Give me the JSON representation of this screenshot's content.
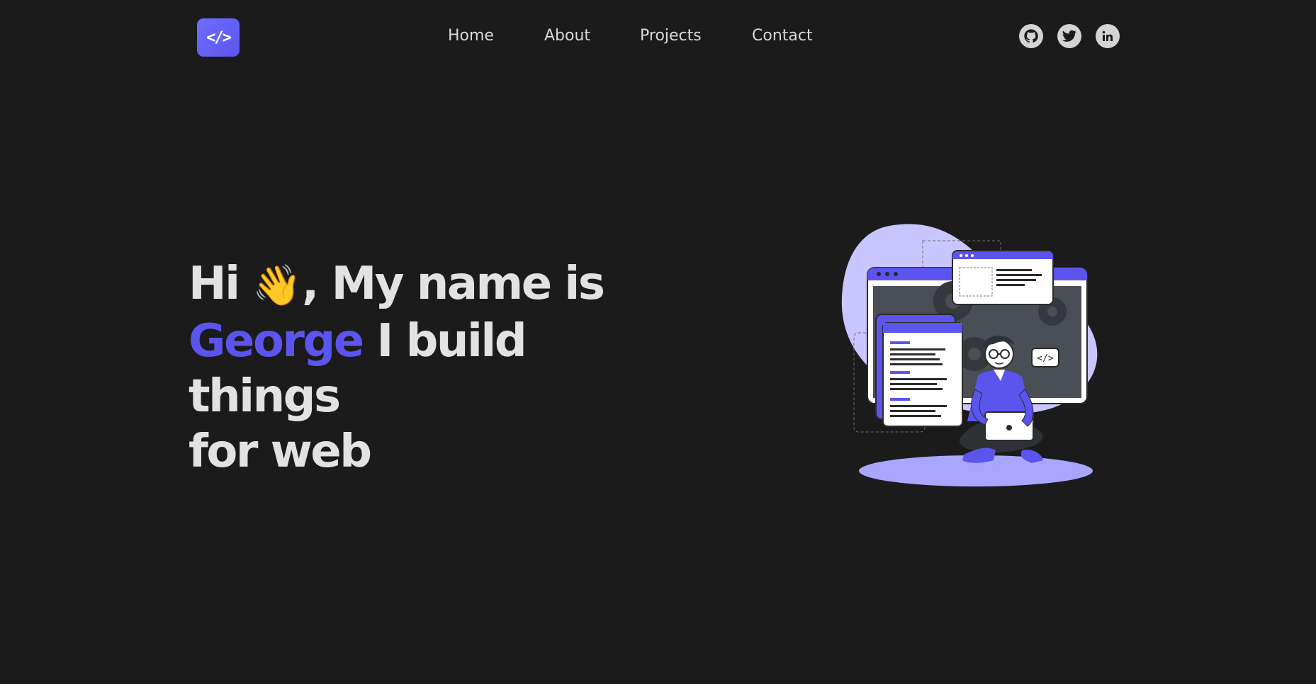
{
  "header": {
    "logo_text": "</>",
    "nav": [
      {
        "label": "Home"
      },
      {
        "label": "About"
      },
      {
        "label": "Projects"
      },
      {
        "label": "Contact"
      }
    ],
    "socials": [
      {
        "icon": "github-icon"
      },
      {
        "icon": "twitter-icon"
      },
      {
        "icon": "linkedin-icon"
      }
    ]
  },
  "hero": {
    "line1_start": "Hi",
    "wave_emoji": "👋",
    "line1_end": ", My name is",
    "name": "George",
    "line2_rest": " I build things",
    "line3": "for web"
  },
  "illustration": {
    "code_tag": "</>"
  },
  "colors": {
    "background": "#1b1b1b",
    "accent": "#5b55ee",
    "text": "#e2e2e2",
    "blob": "#c9c6ff"
  }
}
